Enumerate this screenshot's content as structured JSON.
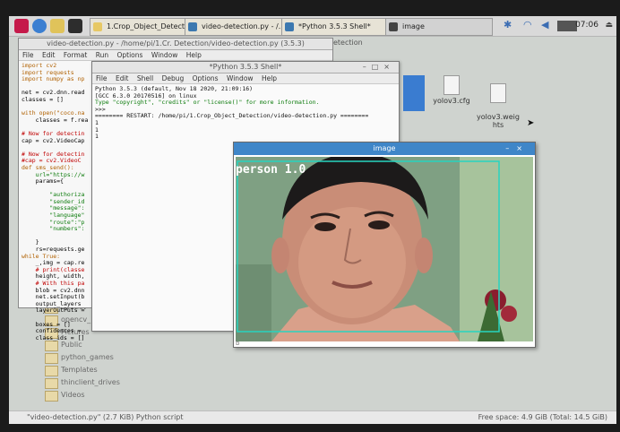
{
  "taskbar": {
    "tasks": [
      {
        "label": "1.Crop_Object_Detect...",
        "icon": "folder-icon"
      },
      {
        "label": "video-detection.py - /...",
        "icon": "python-icon"
      },
      {
        "label": "*Python 3.5.3 Shell*",
        "icon": "python-icon"
      },
      {
        "label": "image",
        "icon": "image-window-icon"
      }
    ],
    "clock": "07:06"
  },
  "desktop_files": [
    "yolov3.cfg",
    "yolov3.weig\nhts"
  ],
  "editor": {
    "title": "video-detection.py - /home/pi/1.Cr. Detection/video-detection.py (3.5.3)",
    "title_suffix": "etection",
    "menu": [
      "File",
      "Edit",
      "Format",
      "Run",
      "Options",
      "Window",
      "Help"
    ],
    "code": [
      "import cv2",
      "import requests",
      "import numpy as np",
      "",
      "net = cv2.dnn.read",
      "classes = []",
      "",
      "with open(\"coco.na",
      "    classes = f.rea",
      "",
      "# Now for detectin",
      "cap = cv2.VideoCap",
      "",
      "# Now for detectin",
      "#cap = cv2.VideoC",
      "def sms_send():",
      "    url=\"https://w",
      "    params={",
      "",
      "        \"authoriza",
      "        \"sender_id",
      "        \"message\":",
      "        \"language\"",
      "        \"route\":\"p",
      "        \"numbers\":",
      "",
      "    }",
      "    rs=requests.ge",
      "while True:",
      "    _,img = cap.re",
      "    # print(classe",
      "    height, width,",
      "    # With this pa",
      "    blob = cv2.dnn",
      "    net.setInput(b",
      "    output_layers",
      "    layerOutPuts =",
      "",
      "    boxes = []",
      "    confidences =",
      "    class_ids = []"
    ]
  },
  "shell": {
    "title": "*Python 3.5.3 Shell*",
    "menu": [
      "File",
      "Edit",
      "Shell",
      "Debug",
      "Options",
      "Window",
      "Help"
    ],
    "lines": [
      "Python 3.5.3 (default, Nov 18 2020, 21:09:16)",
      "[GCC 6.3.0 20170516] on linux",
      "Type \"copyright\", \"credits\" or \"license()\" for more information.",
      ">>>",
      "======== RESTART: /home/pi/1.Crop_Object_Detection/video-detection.py ========",
      "1",
      "1",
      "1"
    ]
  },
  "image_window": {
    "title": "image",
    "detection_label": "person 1.0",
    "footer": "b"
  },
  "file_manager": {
    "items": [
      "opencv",
      "opencv_",
      "Pictures",
      "Public",
      "python_games",
      "Templates",
      "thinclient_drives",
      "Videos"
    ],
    "status_left": "\"video-detection.py\" (2.7 KiB) Python script",
    "status_right": "Free space: 4.9 GiB (Total: 14.5 GiB)"
  },
  "colors": {
    "titlebar_active": "#3f86c8",
    "bbox": "#27d4c0",
    "wall": "#7fa083"
  }
}
